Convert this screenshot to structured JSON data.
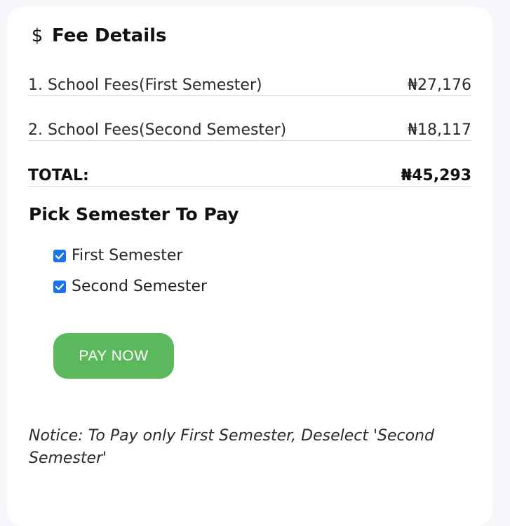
{
  "header": {
    "icon": "dollar-icon",
    "title": "Fee Details"
  },
  "fees": [
    {
      "label": "1. School Fees(First Semester)",
      "amount": "₦27,176"
    },
    {
      "label": "2. School Fees(Second Semester)",
      "amount": "₦18,117"
    }
  ],
  "total": {
    "label": "TOTAL:",
    "amount": "₦45,293"
  },
  "pick": {
    "heading": "Pick Semester To Pay",
    "options": [
      {
        "label": "First Semester",
        "checked": true
      },
      {
        "label": "Second Semester",
        "checked": true
      }
    ]
  },
  "pay_button": {
    "label": "PAY NOW",
    "color": "#5cb85c"
  },
  "notice": "Notice: To Pay only First Semester, Deselect 'Second Semester'",
  "colors": {
    "checkbox": "#1a73e8",
    "card": "#ffffff",
    "background": "#f5f7fb"
  }
}
